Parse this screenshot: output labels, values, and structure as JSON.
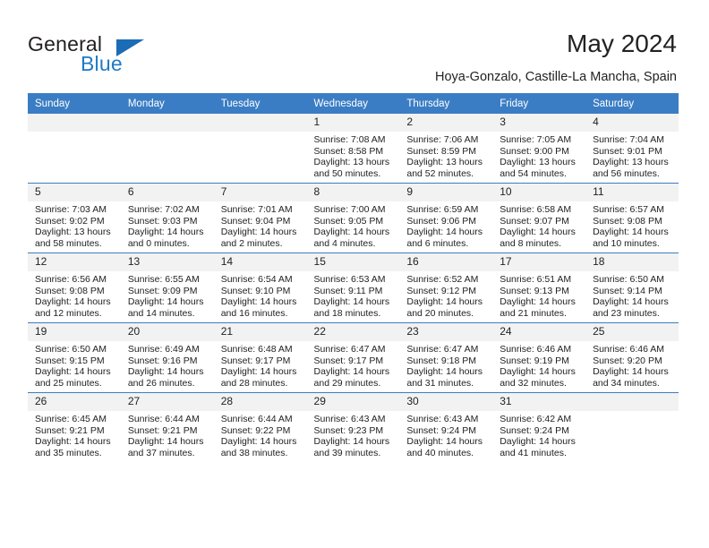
{
  "brand": {
    "name_top": "General",
    "name_bottom": "Blue",
    "accent_color": "#1a6cb5"
  },
  "header": {
    "title": "May 2024",
    "subtitle": "Hoya-Gonzalo, Castille-La Mancha, Spain"
  },
  "calendar": {
    "header_bg": "#3b7dc4",
    "daynum_bg": "#f2f2f2",
    "weekday_headers": [
      "Sunday",
      "Monday",
      "Tuesday",
      "Wednesday",
      "Thursday",
      "Friday",
      "Saturday"
    ],
    "weeks": [
      [
        {
          "day": "",
          "empty": true
        },
        {
          "day": "",
          "empty": true
        },
        {
          "day": "",
          "empty": true
        },
        {
          "day": "1",
          "sunrise": "Sunrise: 7:08 AM",
          "sunset": "Sunset: 8:58 PM",
          "daylight1": "Daylight: 13 hours",
          "daylight2": "and 50 minutes."
        },
        {
          "day": "2",
          "sunrise": "Sunrise: 7:06 AM",
          "sunset": "Sunset: 8:59 PM",
          "daylight1": "Daylight: 13 hours",
          "daylight2": "and 52 minutes."
        },
        {
          "day": "3",
          "sunrise": "Sunrise: 7:05 AM",
          "sunset": "Sunset: 9:00 PM",
          "daylight1": "Daylight: 13 hours",
          "daylight2": "and 54 minutes."
        },
        {
          "day": "4",
          "sunrise": "Sunrise: 7:04 AM",
          "sunset": "Sunset: 9:01 PM",
          "daylight1": "Daylight: 13 hours",
          "daylight2": "and 56 minutes."
        }
      ],
      [
        {
          "day": "5",
          "sunrise": "Sunrise: 7:03 AM",
          "sunset": "Sunset: 9:02 PM",
          "daylight1": "Daylight: 13 hours",
          "daylight2": "and 58 minutes."
        },
        {
          "day": "6",
          "sunrise": "Sunrise: 7:02 AM",
          "sunset": "Sunset: 9:03 PM",
          "daylight1": "Daylight: 14 hours",
          "daylight2": "and 0 minutes."
        },
        {
          "day": "7",
          "sunrise": "Sunrise: 7:01 AM",
          "sunset": "Sunset: 9:04 PM",
          "daylight1": "Daylight: 14 hours",
          "daylight2": "and 2 minutes."
        },
        {
          "day": "8",
          "sunrise": "Sunrise: 7:00 AM",
          "sunset": "Sunset: 9:05 PM",
          "daylight1": "Daylight: 14 hours",
          "daylight2": "and 4 minutes."
        },
        {
          "day": "9",
          "sunrise": "Sunrise: 6:59 AM",
          "sunset": "Sunset: 9:06 PM",
          "daylight1": "Daylight: 14 hours",
          "daylight2": "and 6 minutes."
        },
        {
          "day": "10",
          "sunrise": "Sunrise: 6:58 AM",
          "sunset": "Sunset: 9:07 PM",
          "daylight1": "Daylight: 14 hours",
          "daylight2": "and 8 minutes."
        },
        {
          "day": "11",
          "sunrise": "Sunrise: 6:57 AM",
          "sunset": "Sunset: 9:08 PM",
          "daylight1": "Daylight: 14 hours",
          "daylight2": "and 10 minutes."
        }
      ],
      [
        {
          "day": "12",
          "sunrise": "Sunrise: 6:56 AM",
          "sunset": "Sunset: 9:08 PM",
          "daylight1": "Daylight: 14 hours",
          "daylight2": "and 12 minutes."
        },
        {
          "day": "13",
          "sunrise": "Sunrise: 6:55 AM",
          "sunset": "Sunset: 9:09 PM",
          "daylight1": "Daylight: 14 hours",
          "daylight2": "and 14 minutes."
        },
        {
          "day": "14",
          "sunrise": "Sunrise: 6:54 AM",
          "sunset": "Sunset: 9:10 PM",
          "daylight1": "Daylight: 14 hours",
          "daylight2": "and 16 minutes."
        },
        {
          "day": "15",
          "sunrise": "Sunrise: 6:53 AM",
          "sunset": "Sunset: 9:11 PM",
          "daylight1": "Daylight: 14 hours",
          "daylight2": "and 18 minutes."
        },
        {
          "day": "16",
          "sunrise": "Sunrise: 6:52 AM",
          "sunset": "Sunset: 9:12 PM",
          "daylight1": "Daylight: 14 hours",
          "daylight2": "and 20 minutes."
        },
        {
          "day": "17",
          "sunrise": "Sunrise: 6:51 AM",
          "sunset": "Sunset: 9:13 PM",
          "daylight1": "Daylight: 14 hours",
          "daylight2": "and 21 minutes."
        },
        {
          "day": "18",
          "sunrise": "Sunrise: 6:50 AM",
          "sunset": "Sunset: 9:14 PM",
          "daylight1": "Daylight: 14 hours",
          "daylight2": "and 23 minutes."
        }
      ],
      [
        {
          "day": "19",
          "sunrise": "Sunrise: 6:50 AM",
          "sunset": "Sunset: 9:15 PM",
          "daylight1": "Daylight: 14 hours",
          "daylight2": "and 25 minutes."
        },
        {
          "day": "20",
          "sunrise": "Sunrise: 6:49 AM",
          "sunset": "Sunset: 9:16 PM",
          "daylight1": "Daylight: 14 hours",
          "daylight2": "and 26 minutes."
        },
        {
          "day": "21",
          "sunrise": "Sunrise: 6:48 AM",
          "sunset": "Sunset: 9:17 PM",
          "daylight1": "Daylight: 14 hours",
          "daylight2": "and 28 minutes."
        },
        {
          "day": "22",
          "sunrise": "Sunrise: 6:47 AM",
          "sunset": "Sunset: 9:17 PM",
          "daylight1": "Daylight: 14 hours",
          "daylight2": "and 29 minutes."
        },
        {
          "day": "23",
          "sunrise": "Sunrise: 6:47 AM",
          "sunset": "Sunset: 9:18 PM",
          "daylight1": "Daylight: 14 hours",
          "daylight2": "and 31 minutes."
        },
        {
          "day": "24",
          "sunrise": "Sunrise: 6:46 AM",
          "sunset": "Sunset: 9:19 PM",
          "daylight1": "Daylight: 14 hours",
          "daylight2": "and 32 minutes."
        },
        {
          "day": "25",
          "sunrise": "Sunrise: 6:46 AM",
          "sunset": "Sunset: 9:20 PM",
          "daylight1": "Daylight: 14 hours",
          "daylight2": "and 34 minutes."
        }
      ],
      [
        {
          "day": "26",
          "sunrise": "Sunrise: 6:45 AM",
          "sunset": "Sunset: 9:21 PM",
          "daylight1": "Daylight: 14 hours",
          "daylight2": "and 35 minutes."
        },
        {
          "day": "27",
          "sunrise": "Sunrise: 6:44 AM",
          "sunset": "Sunset: 9:21 PM",
          "daylight1": "Daylight: 14 hours",
          "daylight2": "and 37 minutes."
        },
        {
          "day": "28",
          "sunrise": "Sunrise: 6:44 AM",
          "sunset": "Sunset: 9:22 PM",
          "daylight1": "Daylight: 14 hours",
          "daylight2": "and 38 minutes."
        },
        {
          "day": "29",
          "sunrise": "Sunrise: 6:43 AM",
          "sunset": "Sunset: 9:23 PM",
          "daylight1": "Daylight: 14 hours",
          "daylight2": "and 39 minutes."
        },
        {
          "day": "30",
          "sunrise": "Sunrise: 6:43 AM",
          "sunset": "Sunset: 9:24 PM",
          "daylight1": "Daylight: 14 hours",
          "daylight2": "and 40 minutes."
        },
        {
          "day": "31",
          "sunrise": "Sunrise: 6:42 AM",
          "sunset": "Sunset: 9:24 PM",
          "daylight1": "Daylight: 14 hours",
          "daylight2": "and 41 minutes."
        },
        {
          "day": "",
          "empty": true
        }
      ]
    ]
  }
}
